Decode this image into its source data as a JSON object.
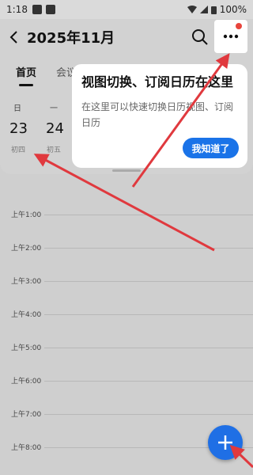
{
  "status_bar": {
    "time": "1:18",
    "battery": "100%"
  },
  "header": {
    "title": "2025年11月"
  },
  "tabs": [
    {
      "label": "首页"
    },
    {
      "label": "会议"
    }
  ],
  "week": {
    "days": [
      {
        "weekday": "日",
        "date": "23",
        "lunar": "初四"
      },
      {
        "weekday": "一",
        "date": "24",
        "lunar": "初五"
      }
    ]
  },
  "timeline": {
    "hours": [
      "上午1:00",
      "上午2:00",
      "上午3:00",
      "上午4:00",
      "上午5:00",
      "上午6:00",
      "上午7:00",
      "上午8:00"
    ]
  },
  "popup": {
    "title": "视图切换、订阅日历在这里",
    "text": "在这里可以快速切换日历视图、订阅日历",
    "button": "我知道了"
  },
  "colors": {
    "accent": "#1a73e8",
    "arrow": "#e0393e",
    "badge": "#e8453c"
  }
}
